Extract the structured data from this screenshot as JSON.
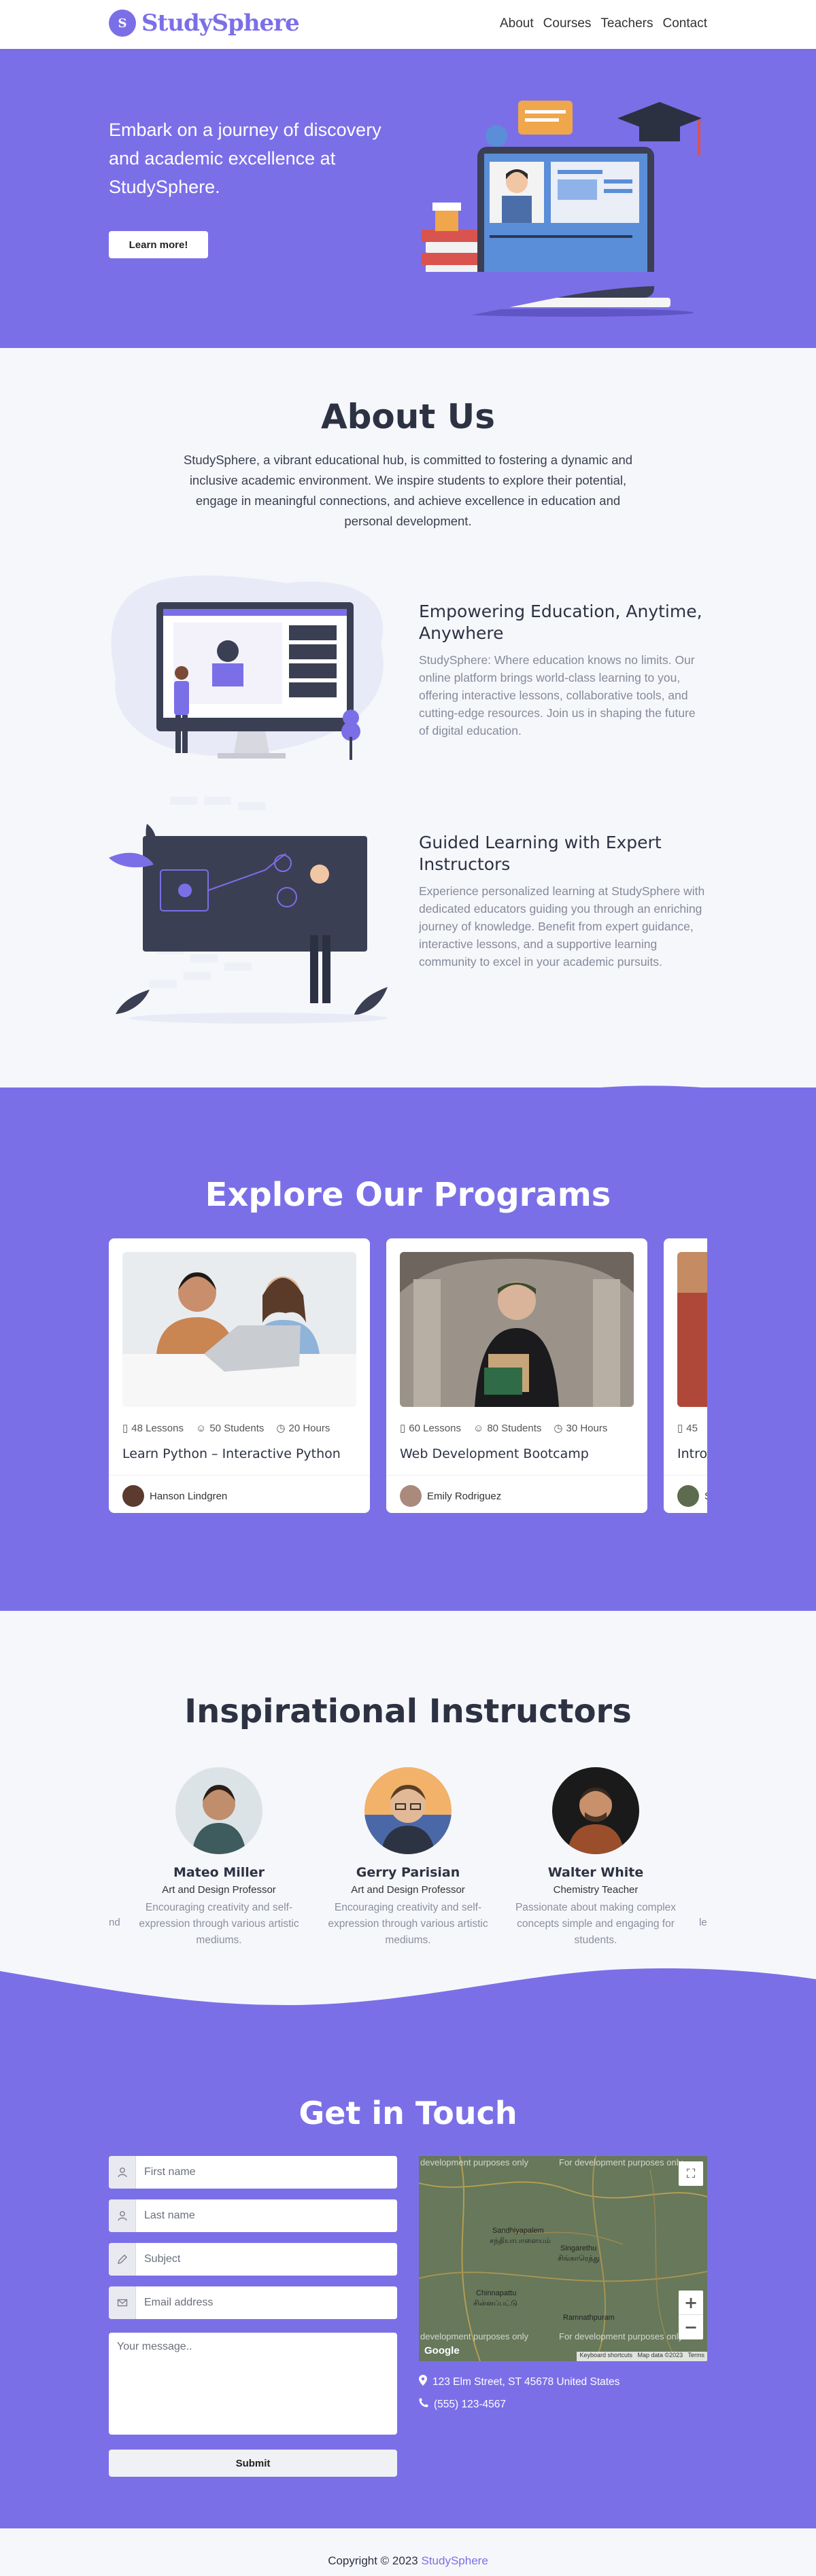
{
  "header": {
    "logo_letter": "S",
    "logo_text": "StudySphere",
    "nav": [
      "About",
      "Courses",
      "Teachers",
      "Contact"
    ]
  },
  "hero": {
    "title": "Embark on a journey of discovery and academic excellence at StudySphere.",
    "button": "Learn more!"
  },
  "about": {
    "title": "About Us",
    "intro": "StudySphere, a vibrant educational hub, is committed to fostering a dynamic and inclusive academic environment. We inspire students to explore their potential, engage in meaningful connections, and achieve excellence in education and personal development.",
    "features": [
      {
        "title": "Empowering Education, Anytime, Anywhere",
        "text": "StudySphere: Where education knows no limits. Our online platform brings world-class learning to you, offering interactive lessons, collaborative tools, and cutting-edge resources. Join us in shaping the future of digital education."
      },
      {
        "title": "Guided Learning with Expert Instructors",
        "text": "Experience personalized learning at StudySphere with dedicated educators guiding you through an enriching journey of knowledge. Benefit from expert guidance, interactive lessons, and a supportive learning community to excel in your academic pursuits."
      }
    ]
  },
  "programs": {
    "title": "Explore Our Programs",
    "courses": [
      {
        "lessons": "48 Lessons",
        "students": "50 Students",
        "hours": "20 Hours",
        "title": "Learn Python – Interactive Python",
        "author": "Hanson Lindgren"
      },
      {
        "lessons": "60 Lessons",
        "students": "80 Students",
        "hours": "30 Hours",
        "title": "Web Development Bootcamp",
        "author": "Emily Rodriguez"
      },
      {
        "lessons": "45",
        "students": "",
        "hours": "",
        "title": "Intro",
        "author": "S"
      }
    ]
  },
  "instructors": {
    "title": "Inspirational Instructors",
    "left_fragment": "nd",
    "right_fragment": "le",
    "people": [
      {
        "name": "Mateo Miller",
        "role": "Art and Design Professor",
        "desc": "Encouraging creativity and self-expression through various artistic mediums."
      },
      {
        "name": "Gerry Parisian",
        "role": "Art and Design Professor",
        "desc": "Encouraging creativity and self-expression through various artistic mediums."
      },
      {
        "name": "Walter White",
        "role": "Chemistry Teacher",
        "desc": "Passionate about making complex concepts simple and engaging for students."
      }
    ]
  },
  "contact": {
    "title": "Get in Touch",
    "placeholders": {
      "first": "First name",
      "last": "Last name",
      "subject": "Subject",
      "email": "Email address",
      "message": "Your message.."
    },
    "submit": "Submit",
    "address": "123 Elm Street, ST 45678 United States",
    "phone": "(555) 123-4567",
    "map": {
      "watermark_left": "development purposes only",
      "watermark_right": "For development purposes only",
      "google": "Google",
      "attribution": "Keyboard shortcuts   Map data ©2023   Terms",
      "places": [
        "Sandhiyapalem",
        "சந்தியாபாளையம்",
        "Singarethu",
        "சிங்காரெத்து",
        "Chinnapattu",
        "சின்னப்பட்டு",
        "Ramnathpuram"
      ]
    }
  },
  "footer": {
    "text": "Copyright © 2023 ",
    "brand": "StudySphere"
  },
  "colors": {
    "accent": "#7b6fe8",
    "dark": "#2d3243",
    "bg": "#f6f7fb"
  }
}
